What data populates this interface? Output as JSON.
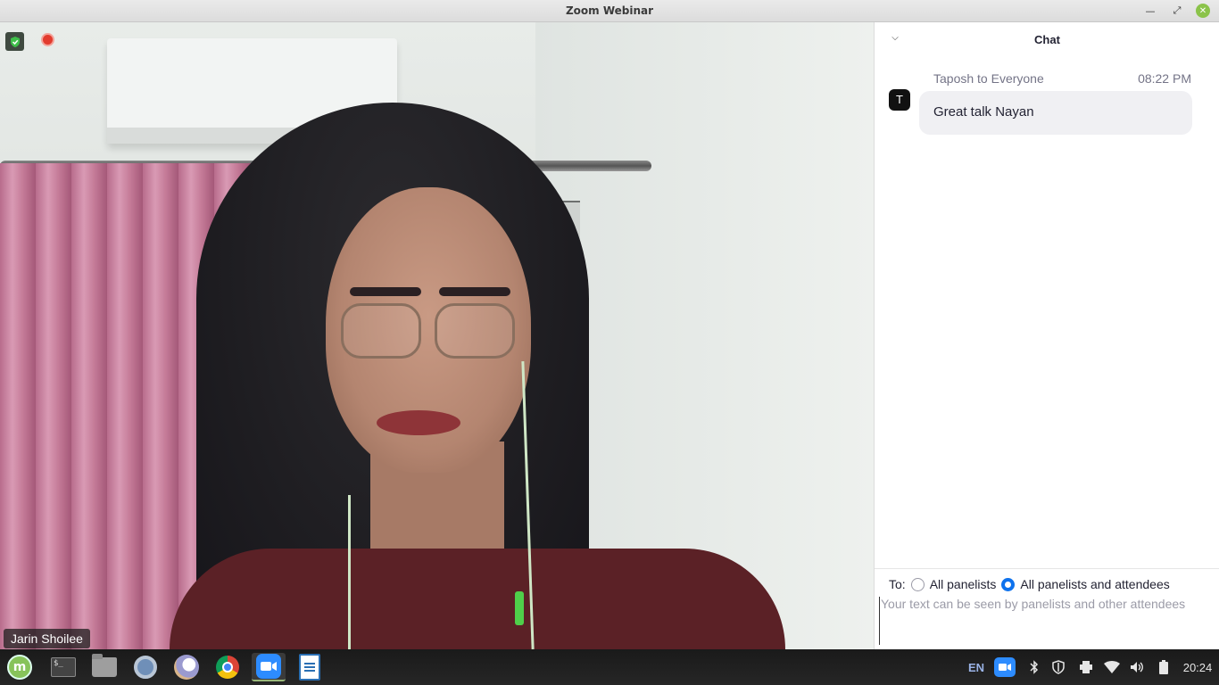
{
  "window": {
    "title": "Zoom Webinar"
  },
  "video": {
    "participant_name": "Jarin Shoilee"
  },
  "chat": {
    "title": "Chat",
    "messages": [
      {
        "sender": "Taposh to Everyone",
        "time": "08:22 PM",
        "avatar": "T",
        "text": "Great talk Nayan"
      }
    ],
    "to_label": "To:",
    "recipients": [
      {
        "label": "All panelists",
        "selected": false
      },
      {
        "label": "All panelists and attendees",
        "selected": true
      }
    ],
    "input_placeholder": "Your text can be seen by panelists and other attendees"
  },
  "taskbar": {
    "apps": [
      "linux-mint-menu-icon",
      "terminal-icon",
      "files-icon",
      "chromium-icon",
      "bird-app-icon",
      "chrome-icon",
      "zoom-icon",
      "writer-icon"
    ],
    "active_app": "zoom-icon",
    "language": "EN",
    "clock": "20:24"
  },
  "colors": {
    "accent": "#0e72ed",
    "zoom_blue": "#2d8cff",
    "recording_red": "#e23b2e"
  }
}
